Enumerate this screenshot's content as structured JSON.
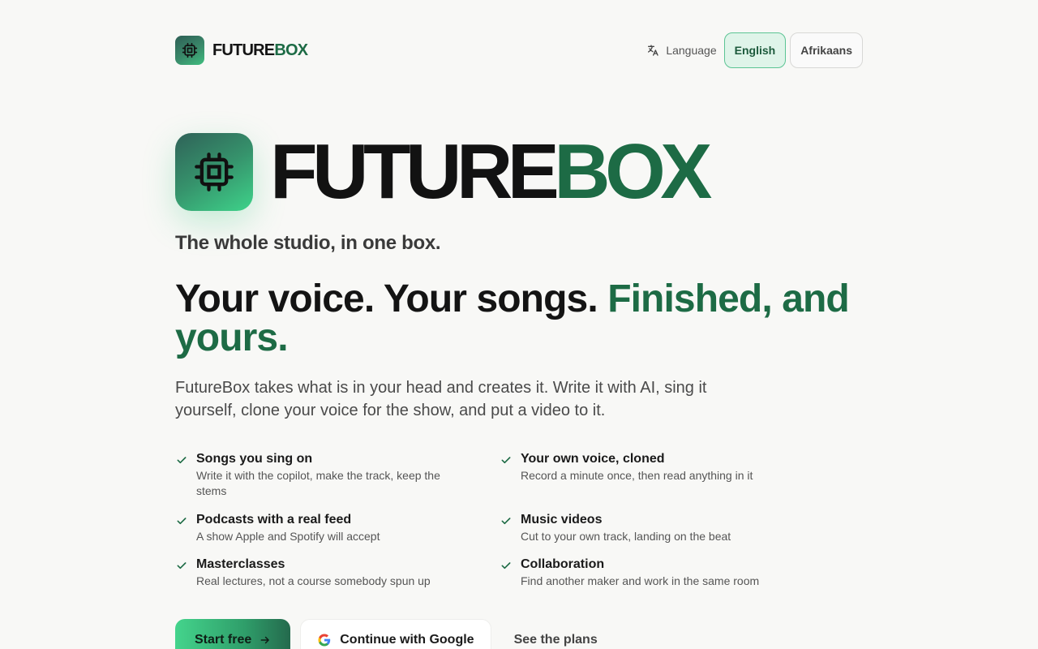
{
  "brand": {
    "name_a": "FUTURE",
    "name_b": "BOX"
  },
  "language": {
    "label": "Language",
    "options": [
      "English",
      "Afrikaans"
    ],
    "selected": "English"
  },
  "hero": {
    "title_a": "FUTURE",
    "title_b": "BOX",
    "tagline": "The whole studio, in one box.",
    "headline_a": "Your voice. Your songs. ",
    "headline_b": "Finished, and yours.",
    "lede": "FutureBox takes what is in your head and creates it. Write it with AI, sing it yourself, clone your voice for the show, and put a video to it."
  },
  "features": [
    {
      "title": "Songs you sing on",
      "desc": "Write it with the copilot, make the track, keep the stems"
    },
    {
      "title": "Your own voice, cloned",
      "desc": "Record a minute once, then read anything in it"
    },
    {
      "title": "Podcasts with a real feed",
      "desc": "A show Apple and Spotify will accept"
    },
    {
      "title": "Music videos",
      "desc": "Cut to your own track, landing on the beat"
    },
    {
      "title": "Masterclasses",
      "desc": "Real lectures, not a course somebody spun up"
    },
    {
      "title": "Collaboration",
      "desc": "Find another maker and work in the same room"
    }
  ],
  "cta": {
    "primary": "Start free",
    "google": "Continue with Google",
    "plans": "See the plans"
  },
  "colors": {
    "accent": "#1d6b45",
    "accent_light": "#3ed38a",
    "background": "#f8f8f6"
  }
}
